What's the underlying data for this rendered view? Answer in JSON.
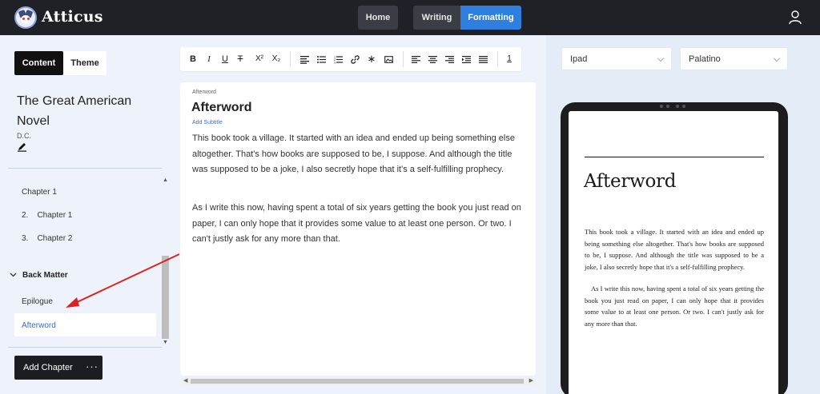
{
  "app": {
    "title": "Atticus"
  },
  "nav": {
    "home": "Home",
    "writing": "Writing",
    "formatting": "Formatting"
  },
  "sidebar": {
    "tabs": {
      "content": "Content",
      "theme": "Theme"
    },
    "book_title": "The Great American Novel",
    "author": "D.C.",
    "chapters": [
      {
        "label": "Chapter 1"
      },
      {
        "label": "2.    Chapter 1"
      },
      {
        "label": "3.    Chapter 2"
      }
    ],
    "back_matter": {
      "label": "Back Matter",
      "items": [
        {
          "label": "Epilogue"
        },
        {
          "label": "Afterword"
        }
      ]
    },
    "add_chapter": "Add Chapter",
    "more": "···"
  },
  "toolbar": {
    "bold": "B",
    "italic": "I",
    "underline": "U",
    "strike": "T",
    "superscript": "X²",
    "subscript": "X₂",
    "page_number": "1"
  },
  "editor": {
    "breadcrumb": "Afterword",
    "title": "Afterword",
    "add_subtitle": "Add Subtitle",
    "paragraphs": [
      "This book took a village. It started with an idea and ended up being something else altogether. That's how books are supposed to be, I suppose. And although the title was supposed to be a joke, I also secretly hope that it's a self-fulfilling prophecy.",
      "As I write this now, having spent a total of six years getting the book you just read on paper, I can only hope that it provides some value to at least one person. Or two. I can't justly ask for any more than that."
    ]
  },
  "preview": {
    "device": "Ipad",
    "font": "Palatino",
    "title": "Afterword",
    "paragraphs": [
      "This book took a village. It started with an idea and ended up being something else altogether. That's how books are supposed to be, I suppose. And although the title was supposed to be a joke, I also secretly hope that it's a self-fulfilling prophecy.",
      "As I write this now, having spent a total of six years getting the book you just read on paper, I can only hope that it provides some value to at least one person. Or two. I can't justly ask for any more than that."
    ]
  },
  "colors": {
    "accent": "#2f7fe0",
    "topbar": "#1f2126",
    "link": "#2f6fd0",
    "annotation": "#e02020"
  }
}
